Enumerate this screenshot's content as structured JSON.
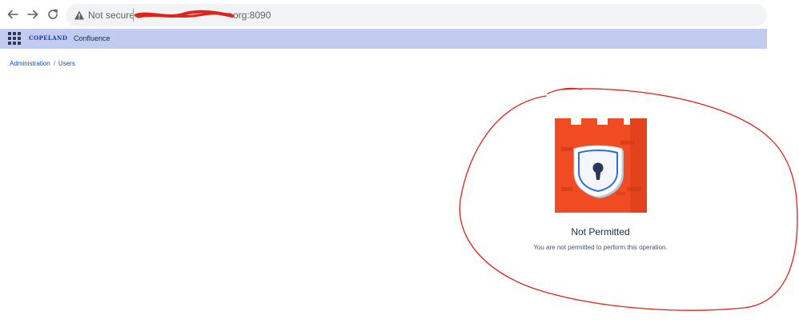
{
  "browser": {
    "security_label": "Not secure",
    "url_visible_suffix": "org:8090",
    "icons": [
      "back-arrow-icon",
      "forward-arrow-icon",
      "reload-icon",
      "warning-icon"
    ]
  },
  "header": {
    "brand": "COPELAND",
    "product": "Confluence",
    "background_color": "#c2cbf0"
  },
  "breadcrumb": {
    "items": [
      "Administration",
      "Users"
    ],
    "separator": "/"
  },
  "error": {
    "title": "Not Permitted",
    "message": "You are not permitted to perform this operation.",
    "illustration": "castle-lock-icon",
    "illustration_color": "#f04b23"
  },
  "annotation": {
    "color": "#e0221b",
    "shape": "hand-drawn circle around error message"
  }
}
